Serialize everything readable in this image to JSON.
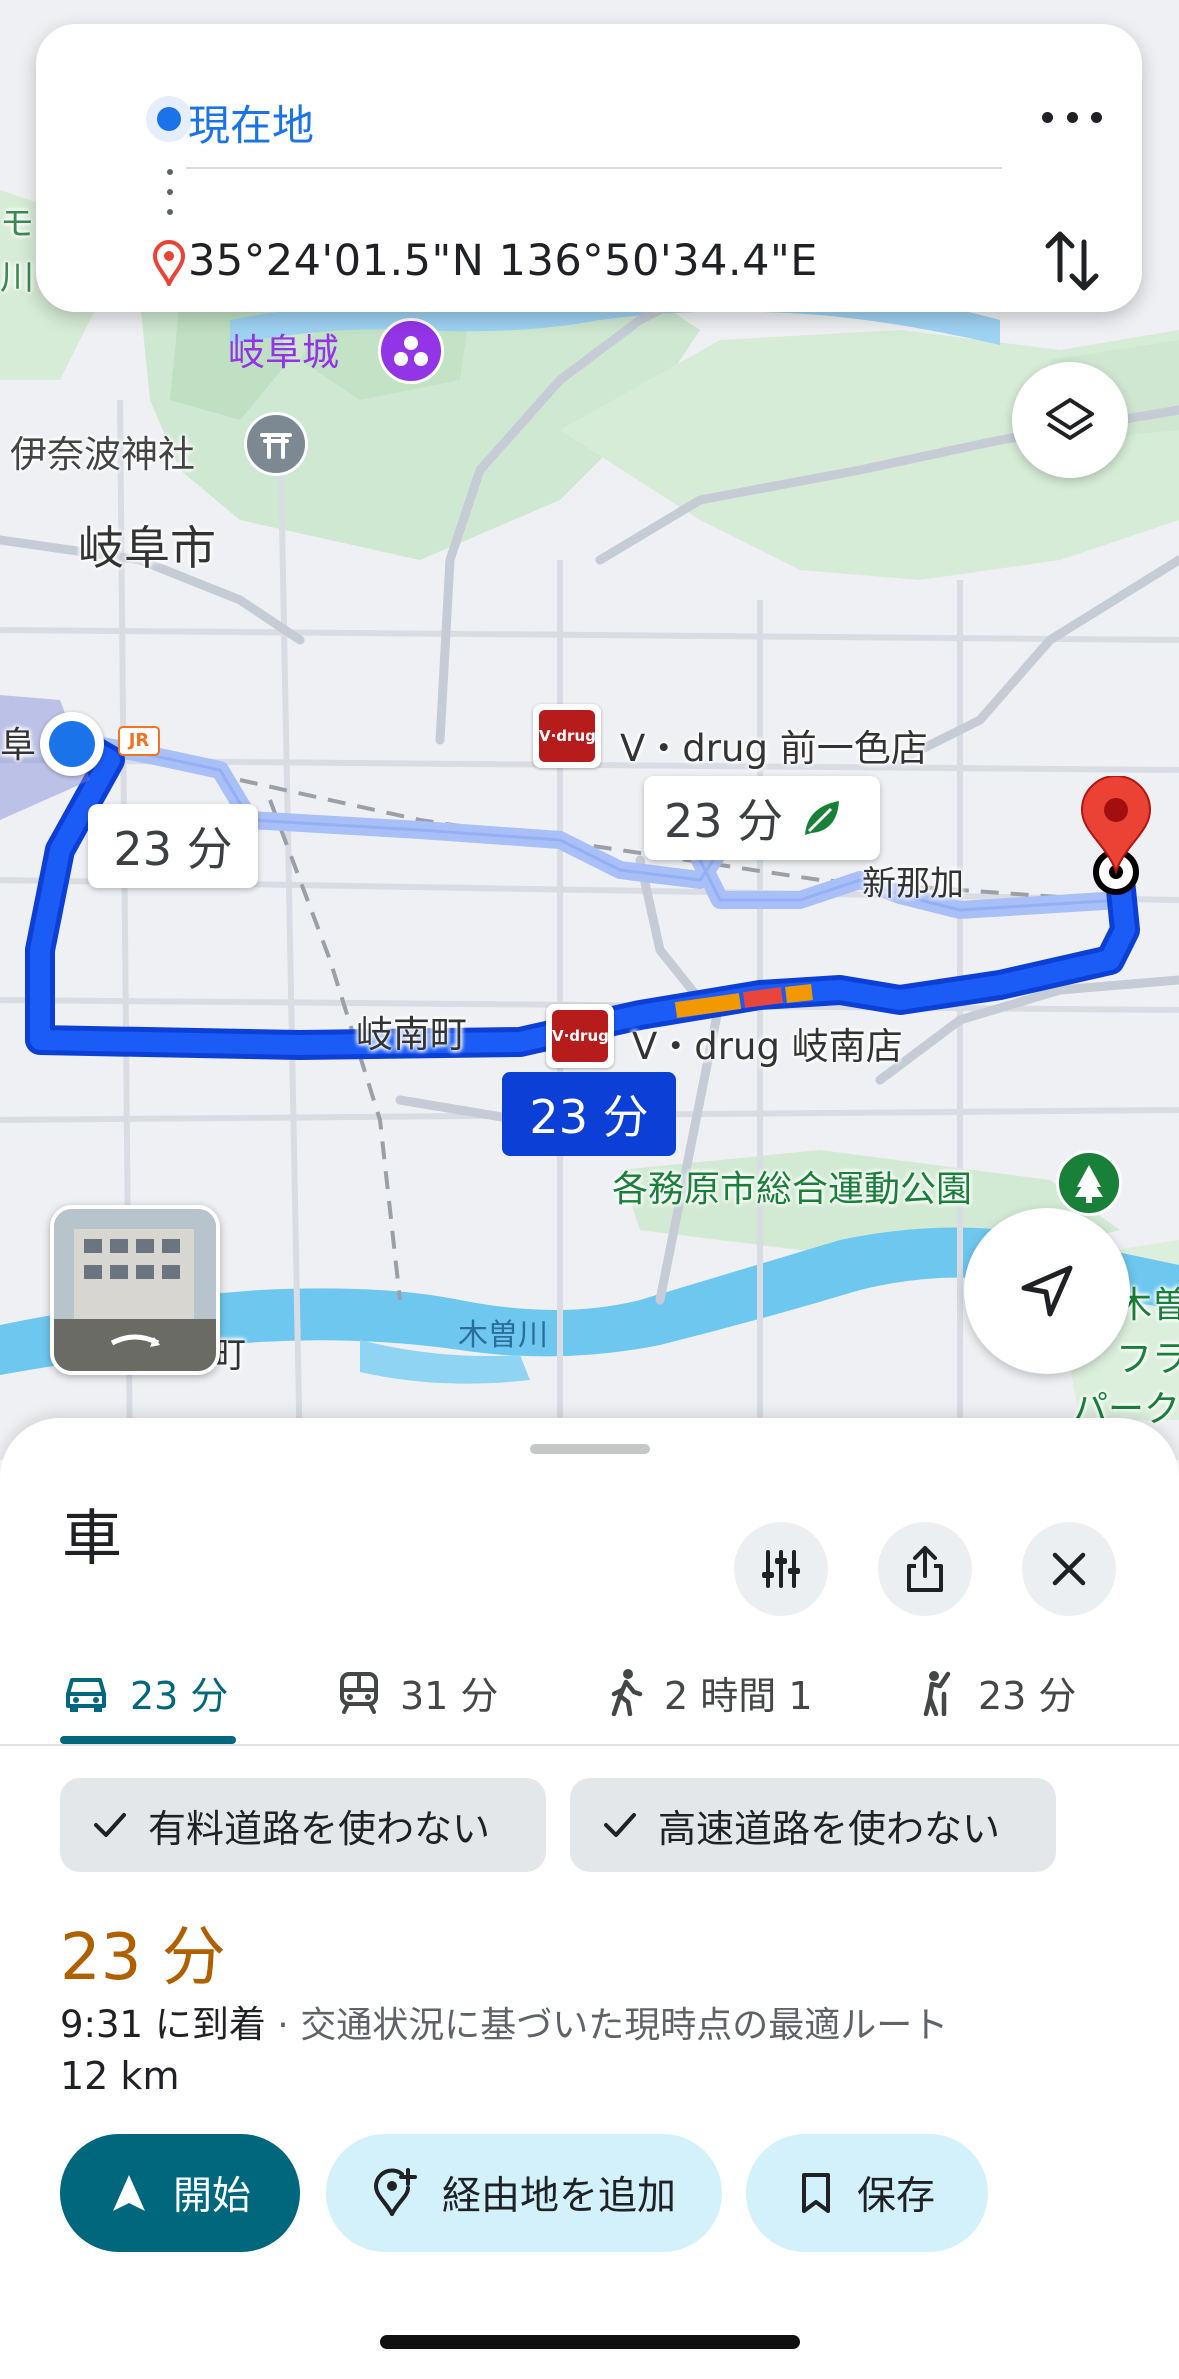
{
  "search": {
    "origin": "現在地",
    "destination": "35°24'01.5\"N 136°50'34.4\"E"
  },
  "map": {
    "labels": {
      "castle": "岐阜城",
      "shrine": "伊奈波神社",
      "city": "岐阜市",
      "station_left": "阜",
      "shinnaka": "新那加",
      "ginan": "岐南町",
      "park": "各務原市総合運動公園",
      "river": "木曽川",
      "kiso_cut": "木曽",
      "fra_cut": "フラ",
      "park_cut": "パーク",
      "mo_cut": "モ",
      "kawa_cut": "川",
      "machi_cut": "町",
      "jr": "JR",
      "store1": "V・drug 前一色店",
      "store2": "V・drug 岐南店",
      "store_logo": "V·drug"
    },
    "route_bubbles": {
      "left": "23 分",
      "eco": "23 分",
      "selected": "23 分"
    },
    "route_line_colors": {
      "selected": "#1a5cf5",
      "alternate": "#a9bff7",
      "traffic_slow": "#f29900",
      "traffic_heavy": "#e8453c"
    }
  },
  "sheet": {
    "title": "車",
    "tabs": [
      {
        "icon": "car-icon",
        "label": "23 分"
      },
      {
        "icon": "train-icon",
        "label": "31 分"
      },
      {
        "icon": "walk-icon",
        "label": "2 時間 1"
      },
      {
        "icon": "hail-icon",
        "label": "23 分"
      }
    ],
    "chips": [
      "有料道路を使わない",
      "高速道路を使わない"
    ],
    "duration": "23 分",
    "arrival": "9:31 に到着",
    "arrival_note": " · 交通状況に基づいた現時点の最適ルート",
    "distance": "12 km",
    "actions": {
      "start": "開始",
      "add_stop": "経由地を追加",
      "save": "保存"
    }
  },
  "colors": {
    "accent": "#00677d",
    "duration": "#b06000",
    "route_blue": "#1a5cf5",
    "pin_red": "#ea4335"
  }
}
